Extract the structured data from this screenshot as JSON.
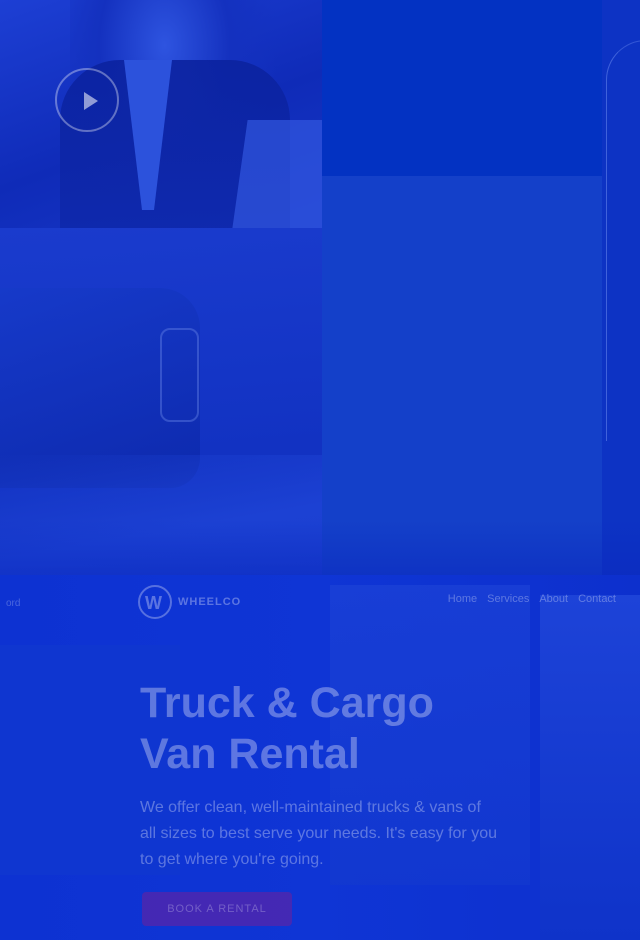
{
  "header": {
    "logo_text": "WHEELCO",
    "left_label": "ord",
    "menu": [
      "Home",
      "Services",
      "About",
      "Contact"
    ]
  },
  "hero": {
    "title_line1": "Truck & Cargo",
    "title_line2": "Van Rental",
    "description": "We offer clean, well-maintained trucks & vans of all sizes to best serve your needs. It's easy for you to get where you're going.",
    "cta_label": "BOOK A RENTAL"
  },
  "colors": {
    "overlay_blue": "#0d32d2",
    "cta_accent": "#aa1478"
  },
  "icons": [
    "play-icon",
    "wheelco-logo-icon"
  ]
}
